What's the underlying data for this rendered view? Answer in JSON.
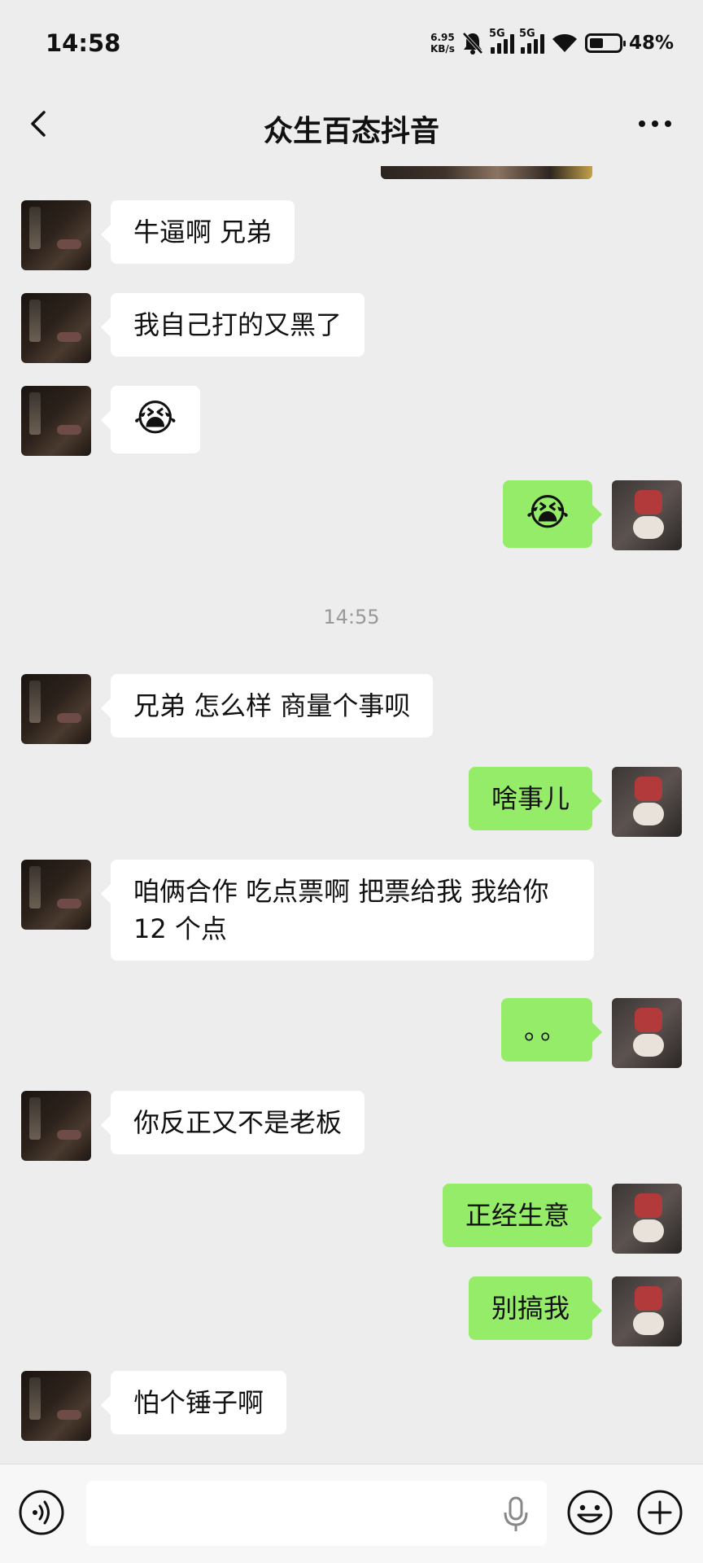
{
  "status_bar": {
    "time": "14:58",
    "net_speed_value": "6.95",
    "net_speed_unit": "KB/s",
    "signal1_label": "5G",
    "signal2_label": "5G",
    "battery_percent": "48%",
    "battery_level": 0.48,
    "icons": [
      "mute-bell-icon",
      "signal-icon",
      "signal-icon",
      "wifi-icon",
      "battery-icon"
    ]
  },
  "nav": {
    "title": "众生百态抖音",
    "back_icon": "chevron-left-icon",
    "more_icon": "more-dots-icon"
  },
  "messages": [
    {
      "side": "left",
      "text": "牛逼啊 兄弟"
    },
    {
      "side": "left",
      "text": "我自己打的又黑了"
    },
    {
      "side": "left",
      "text": "😭"
    },
    {
      "side": "right",
      "text": "😭"
    },
    {
      "side": "left",
      "text": "兄弟 怎么样 商量个事呗"
    },
    {
      "side": "right",
      "text": "啥事儿"
    },
    {
      "side": "left",
      "text": "咱俩合作 吃点票啊 把票给我 我给你 12 个点"
    },
    {
      "side": "right",
      "text": "。。"
    },
    {
      "side": "left",
      "text": "你反正又不是老板"
    },
    {
      "side": "right",
      "text": "正经生意"
    },
    {
      "side": "right",
      "text": "别搞我"
    },
    {
      "side": "left",
      "text": "怕个锤子啊"
    }
  ],
  "timestamp": "14:55",
  "input_bar": {
    "voice_icon": "voice-mode-icon",
    "text_value": "",
    "mic_icon": "microphone-icon",
    "emoji_icon": "emoji-face-icon",
    "plus_icon": "plus-circle-icon"
  },
  "colors": {
    "background": "#ededed",
    "incoming_bubble": "#ffffff",
    "outgoing_bubble": "#95ec69",
    "timestamp_text": "#999999"
  }
}
